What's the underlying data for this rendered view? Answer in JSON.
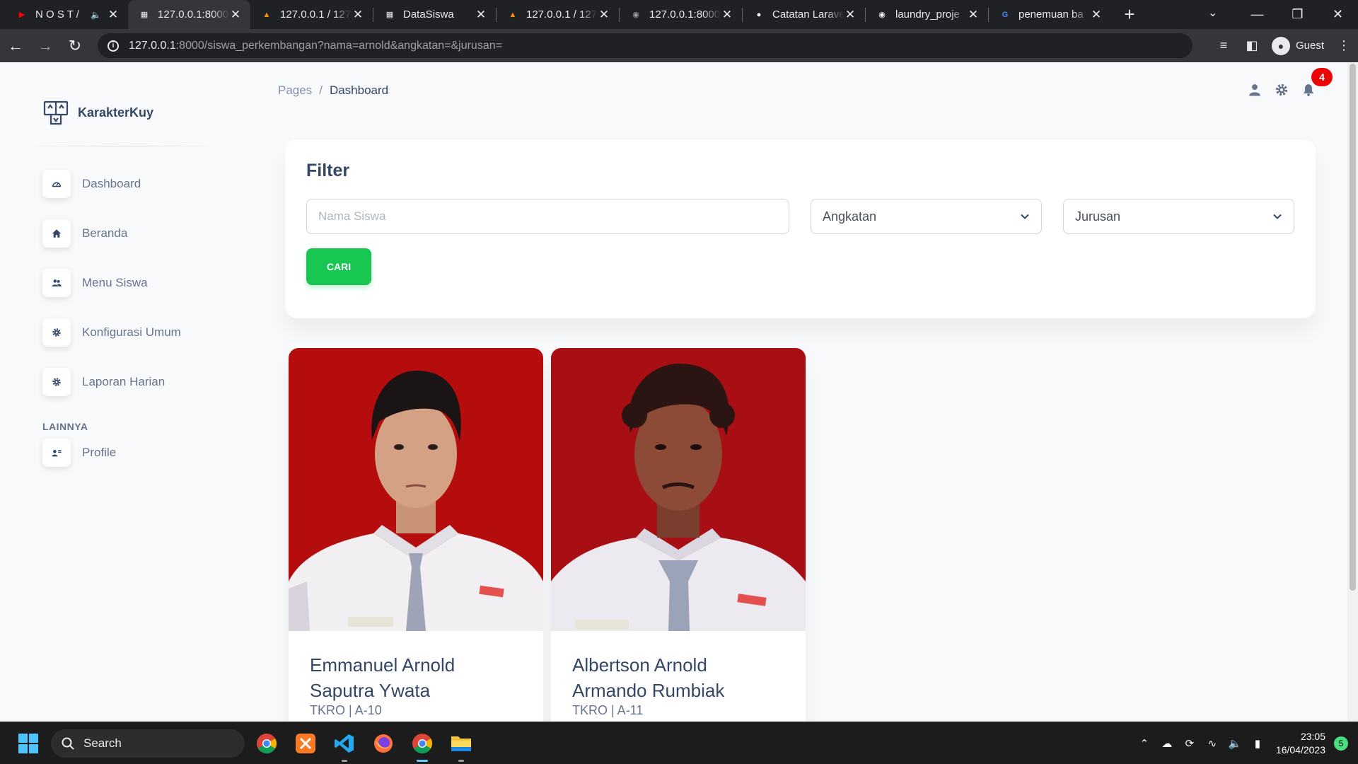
{
  "browser": {
    "tabs": [
      {
        "title": "N O S T /",
        "favicon": "youtube-icon",
        "color": "#ff0000",
        "active": false,
        "audio": true
      },
      {
        "title": "127.0.0.1:8000",
        "favicon": "page-icon",
        "color": "#e8eaed",
        "active": true
      },
      {
        "title": "127.0.0.1 / 127",
        "favicon": "phpmyadmin-icon",
        "color": "#f29111",
        "active": false
      },
      {
        "title": "DataSiswa",
        "favicon": "page-icon",
        "color": "#e8eaed",
        "active": false
      },
      {
        "title": "127.0.0.1 / 127",
        "favicon": "phpmyadmin-icon",
        "color": "#f29111",
        "active": false
      },
      {
        "title": "127.0.0.1:8000",
        "favicon": "globe-icon",
        "color": "#9aa0a6",
        "active": false
      },
      {
        "title": "Catatan Larave",
        "favicon": "medium-icon",
        "color": "#ffffff",
        "active": false
      },
      {
        "title": "laundry_proje",
        "favicon": "github-icon",
        "color": "#ffffff",
        "active": false
      },
      {
        "title": "penemuan ba",
        "favicon": "google-icon",
        "color": "#4285f4",
        "active": false
      }
    ],
    "url_host": "127.0.0.1",
    "url_path": ":8000/siswa_perkembangan?nama=arnold&angkatan=&jurusan=",
    "profile_label": "Guest"
  },
  "sidebar": {
    "brand": "KarakterKuy",
    "items": [
      {
        "label": "Dashboard",
        "icon": "dashboard-icon"
      },
      {
        "label": "Beranda",
        "icon": "home-icon"
      },
      {
        "label": "Menu Siswa",
        "icon": "users-icon"
      },
      {
        "label": "Konfigurasi Umum",
        "icon": "gear-icon"
      },
      {
        "label": "Laporan Harian",
        "icon": "gear-icon"
      }
    ],
    "section_label": "LAINNYA",
    "profile_item": {
      "label": "Profile",
      "icon": "profile-icon"
    }
  },
  "header": {
    "breadcrumb_root": "Pages",
    "breadcrumb_sep": "/",
    "breadcrumb_current": "Dashboard",
    "notification_count": "4"
  },
  "filter": {
    "title": "Filter",
    "name_placeholder": "Nama Siswa",
    "angkatan_label": "Angkatan",
    "jurusan_label": "Jurusan",
    "submit_label": "CARI",
    "accent_color": "#17c751"
  },
  "students": [
    {
      "name": "Emmanuel Arnold Saputra Ywata",
      "info": "TKRO | A-10"
    },
    {
      "name": "Albertson Arnold Armando Rumbiak",
      "info": "TKRO | A-11"
    }
  ],
  "taskbar": {
    "search_label": "Search",
    "time": "23:05",
    "date": "16/04/2023",
    "notification_count": "5"
  }
}
